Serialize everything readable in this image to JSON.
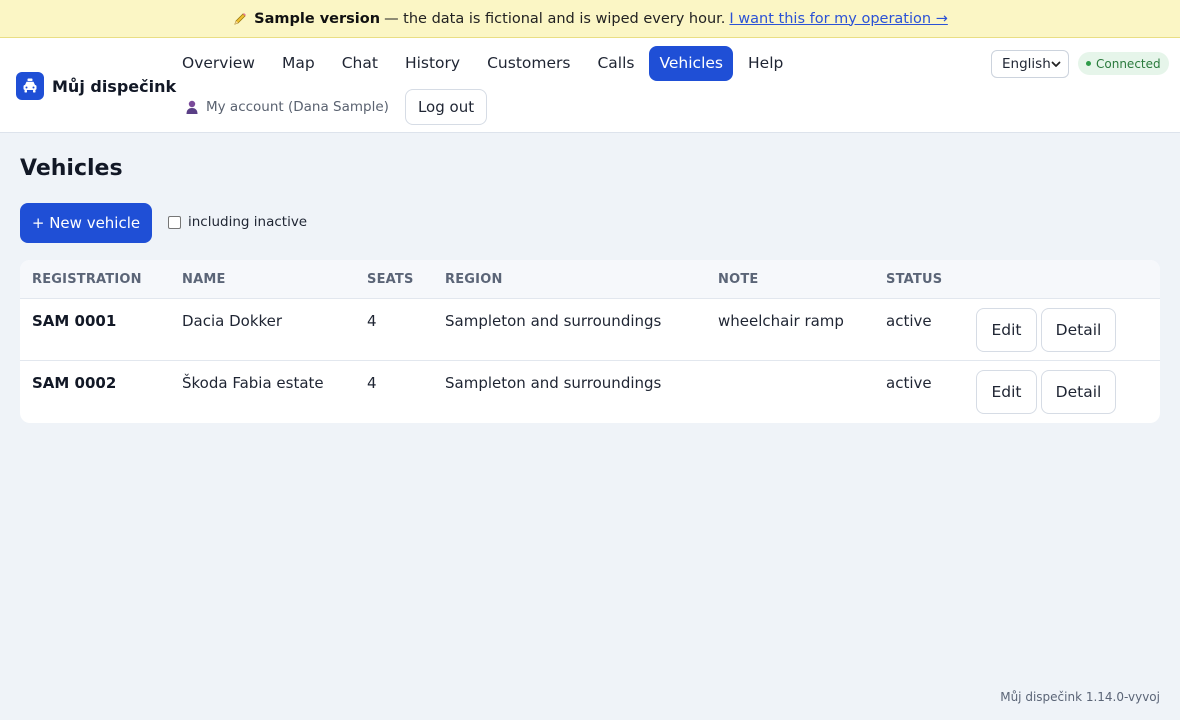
{
  "banner": {
    "title": "Sample version",
    "text": "— the data is fictional and is wiped every hour.",
    "link": "I want this for my operation →",
    "icon": "pencil-icon"
  },
  "header": {
    "brand": "Můj dispečink",
    "brand_icon": "taxi-icon",
    "nav": [
      {
        "label": "Overview"
      },
      {
        "label": "Map"
      },
      {
        "label": "Chat"
      },
      {
        "label": "History"
      },
      {
        "label": "Customers"
      },
      {
        "label": "Calls"
      },
      {
        "label": "Vehicles",
        "active": true
      },
      {
        "label": "Help"
      }
    ],
    "account": "My account (Dana Sample)",
    "account_icon": "person-icon",
    "logout": "Log out",
    "language": "English",
    "status": "Connected"
  },
  "main": {
    "title": "Vehicles",
    "new_button": "+ New vehicle",
    "inactive_label": "including inactive",
    "inactive_checked": false,
    "table": {
      "headers": [
        "REGISTRATION",
        "NAME",
        "SEATS",
        "REGION",
        "NOTE",
        "STATUS"
      ],
      "rows": [
        {
          "registration": "SAM 0001",
          "name": "Dacia Dokker",
          "seats": "4",
          "region": "Sampleton and surroundings",
          "note": "wheelchair ramp",
          "status": "active"
        },
        {
          "registration": "SAM 0002",
          "name": "Škoda Fabia estate",
          "seats": "4",
          "region": "Sampleton and surroundings",
          "note": "",
          "status": "active"
        }
      ],
      "edit_label": "Edit",
      "detail_label": "Detail"
    }
  },
  "footer": "Můj dispečink 1.14.0-vyvoj",
  "colors": {
    "accent": "#1f4fd6",
    "banner_bg": "#fbf6c5",
    "page_bg": "#eff3f8",
    "connected_bg": "#e6f5ea",
    "connected_text": "#2b7a3d"
  }
}
